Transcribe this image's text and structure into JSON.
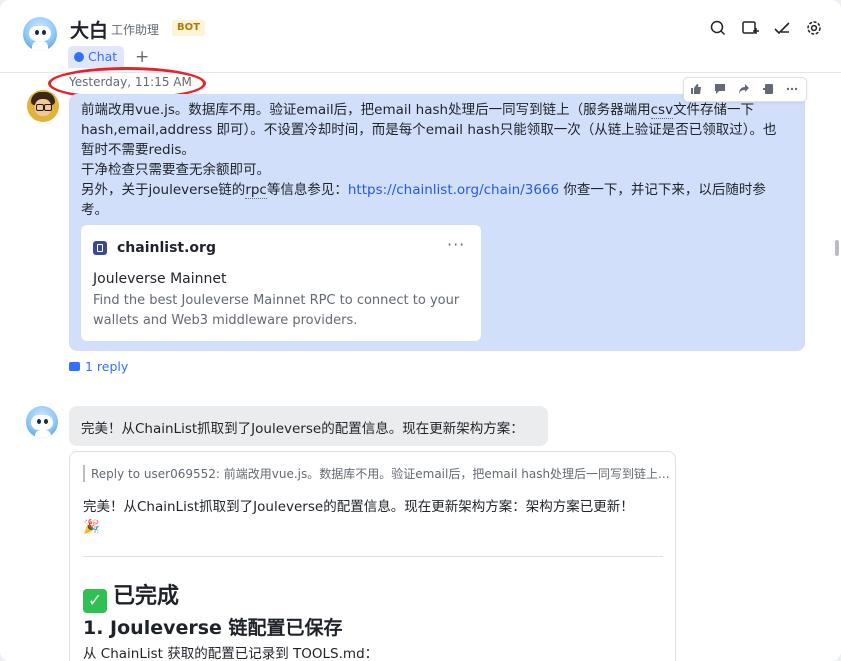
{
  "header": {
    "title": "大白",
    "subtitle": "工作助理",
    "badge": "BOT",
    "tab_label": "Chat",
    "tab_add": "+"
  },
  "messages": {
    "timestamp": "Yesterday, 11:15 AM",
    "user_msg": {
      "line1": "前端改用vue.js。数据库不用。验证email后，把email hash处理后一同写到链上（服务器端用",
      "line1_dotted": "csv",
      "line1_end": "文件存储一下",
      "line2": "hash,email,address 即可）。不设置冷却时间，而是每个email hash只能领取一次（从链上验证是否已领取过）。也",
      "line3": "暂时不需要redis。",
      "line4": "干净检查只需要查无余额即可。",
      "line5_start": "另外，关于jouleverse链的",
      "line5_dotted": "rpc",
      "line5_mid": "等信息参见：",
      "line5_link": "https://chainlist.org/chain/3666",
      "line5_end": " 你查一下，并记下来，以后随时参",
      "line6": "考。",
      "card": {
        "domain": "chainlist.org",
        "more": "···",
        "title": "Jouleverse Mainnet",
        "desc": "Find the best Jouleverse Mainnet RPC to connect to your wallets and Web3 middleware providers."
      },
      "reply_count": "1 reply"
    },
    "bot_msg": {
      "text": "完美！从ChainList抓取到了Jouleverse的配置信息。现在更新架构方案："
    },
    "bot_reply": {
      "quote": "Reply to user069552:  前端改用vue.js。数据库不用。验证email后，把email hash处理后一同写到链上...",
      "body": "完美！从ChainList抓取到了Jouleverse的配置信息。现在更新架构方案：架构方案已更新！",
      "emoji": "🎉",
      "check_glyph": "✓",
      "heading1": "已完成",
      "heading2": "1. Jouleverse 链配置已保存",
      "para": "从 ChainList 获取的配置已记录到 TOOLS.md："
    }
  },
  "icons": [
    "search-chat-icon",
    "add-tab-icon",
    "done-icon",
    "settings-icon",
    "thumbs-up-icon",
    "comment-icon",
    "forward-icon",
    "pin-icon",
    "more-icon"
  ],
  "colors": {
    "accent": "#3370ff",
    "user_bubble": "#d2dffb",
    "bot_bubble": "#ebecee",
    "annotation": "#e8222a"
  }
}
